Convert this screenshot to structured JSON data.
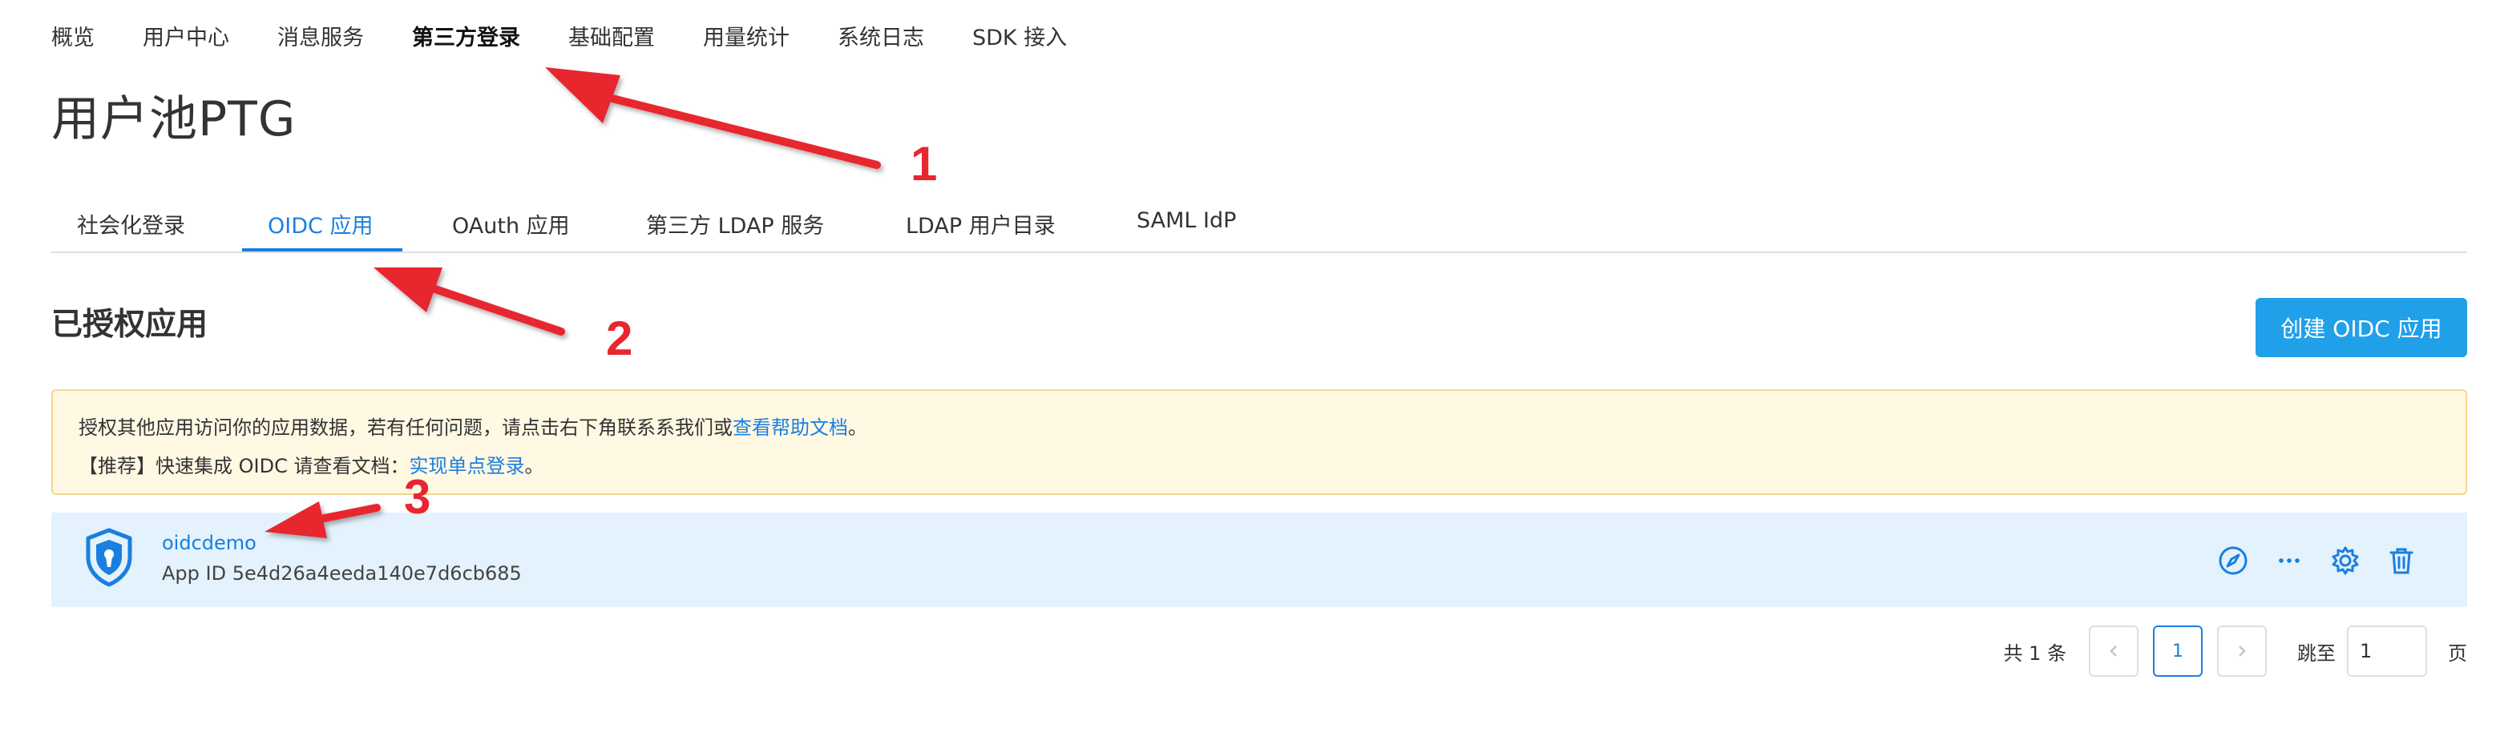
{
  "topnav": {
    "items": [
      "概览",
      "用户中心",
      "消息服务",
      "第三方登录",
      "基础配置",
      "用量统计",
      "系统日志",
      "SDK 接入"
    ],
    "active_index": 3
  },
  "page": {
    "title": "用户池PTG"
  },
  "subtabs": {
    "items": [
      "社会化登录",
      "OIDC 应用",
      "OAuth 应用",
      "第三方 LDAP 服务",
      "LDAP 用户目录",
      "SAML IdP"
    ],
    "active_index": 1
  },
  "section": {
    "title": "已授权应用",
    "create_button": "创建 OIDC 应用"
  },
  "notice": {
    "line1_text": "授权其他应用访问你的应用数据，若有任何问题，请点击右下角联系系我们或 ",
    "line1_link": "查看帮助文档",
    "line1_suffix": " 。",
    "line2_text": "【推荐】快速集成 OIDC 请查看文档：",
    "line2_link": "实现单点登录",
    "line2_suffix": "。"
  },
  "app": {
    "name": "oidcdemo",
    "app_id": "App ID 5e4d26a4eeda140e7d6cb685",
    "icon": "shield-icon",
    "actions": [
      "compass-icon",
      "more-icon",
      "gear-icon",
      "trash-icon"
    ]
  },
  "pagination": {
    "total": "共 1 条",
    "current_page": "1",
    "jump_label": "跳至",
    "jump_value": "1",
    "page_unit": "页"
  },
  "annotations": {
    "labels": [
      "1",
      "2",
      "3"
    ],
    "color": "#e8262f"
  },
  "colors": {
    "accent": "#1a7fe0",
    "button": "#21a0ea",
    "notice_bg": "#fff8e3",
    "row_bg": "#e3f2fc"
  }
}
